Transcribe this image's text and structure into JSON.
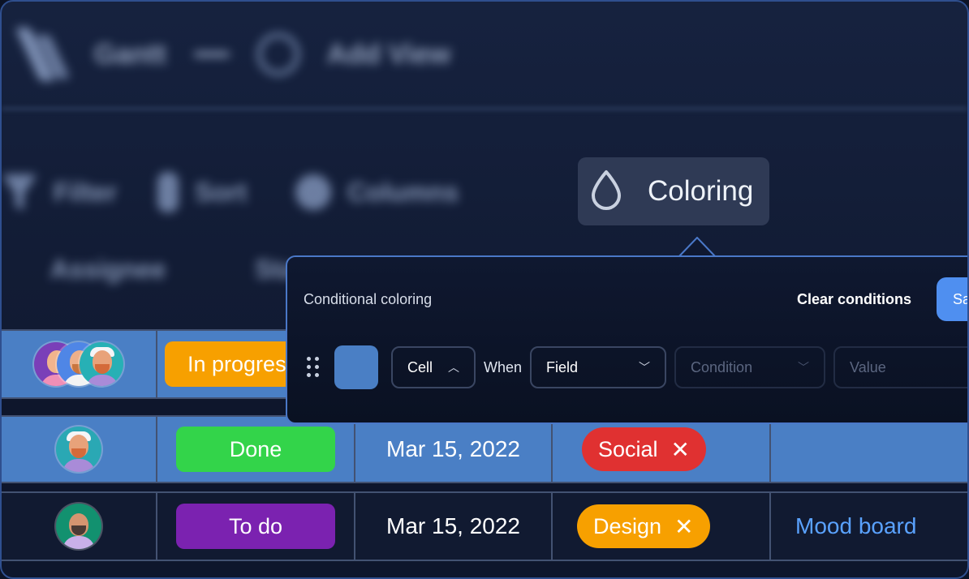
{
  "topbar": {
    "title": "Gantt",
    "add_view": "Add View"
  },
  "toolbar": {
    "filter": "Filter",
    "sort": "Sort",
    "columns": "Columns",
    "coloring": "Coloring",
    "row2": [
      "Assignee",
      "Sta"
    ]
  },
  "popover": {
    "title": "Conditional coloring",
    "clear": "Clear conditions",
    "save": "Sa",
    "rule": {
      "scope": "Cell",
      "when": "When",
      "field": "Field",
      "condition_placeholder": "Condition",
      "value_placeholder": "Value",
      "swatch_color": "#4a7fc5"
    }
  },
  "rows": [
    {
      "status": "In progress",
      "status_color": "#f7a000",
      "assignees": 3
    },
    {
      "status": "Done",
      "status_color": "#33d44a",
      "date": "Mar 15, 2022",
      "tag": "Social",
      "tag_color": "#e03131",
      "row_color": "#4a7fc5"
    },
    {
      "status": "To do",
      "status_color": "#7b22b0",
      "date": "Mar 15, 2022",
      "tag": "Design",
      "tag_color": "#f7a000",
      "link": "Mood board"
    }
  ],
  "colors": {
    "accent": "#4f8ff0",
    "row_highlight": "#4a7fc5",
    "link": "#5aa2ff"
  }
}
